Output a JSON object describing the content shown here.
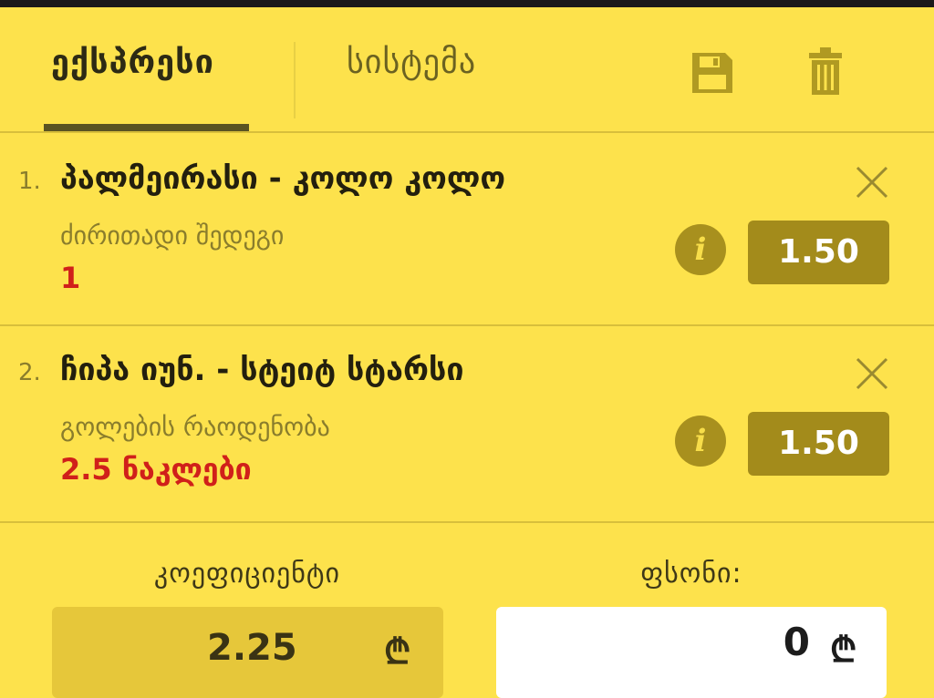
{
  "tabs": {
    "express": "ექსპრესი",
    "system": "სისტემა"
  },
  "icons": {
    "save": "save-icon",
    "trash": "trash-icon",
    "close": "close-icon",
    "info": "info-icon"
  },
  "colors": {
    "background": "#fde24c",
    "accent_dark": "#a38b1b",
    "selection_red": "#d0201a"
  },
  "bets": [
    {
      "number": "1.",
      "title": "პალმეირასი - კოლო კოლო",
      "market": "ძირითადი შედეგი",
      "selection": "1",
      "odds": "1.50",
      "info_glyph": "i"
    },
    {
      "number": "2.",
      "title": "ჩიპა იუნ. - სტეიტ სტარსი",
      "market": "გოლების რაოდენობა",
      "selection": "2.5 ნაკლები",
      "odds": "1.50",
      "info_glyph": "i"
    }
  ],
  "summary": {
    "coefficient_label": "კოეფიციენტი",
    "coefficient_value": "2.25",
    "stake_label": "ფსონი:",
    "stake_value": "0",
    "currency_symbol": "₾"
  }
}
